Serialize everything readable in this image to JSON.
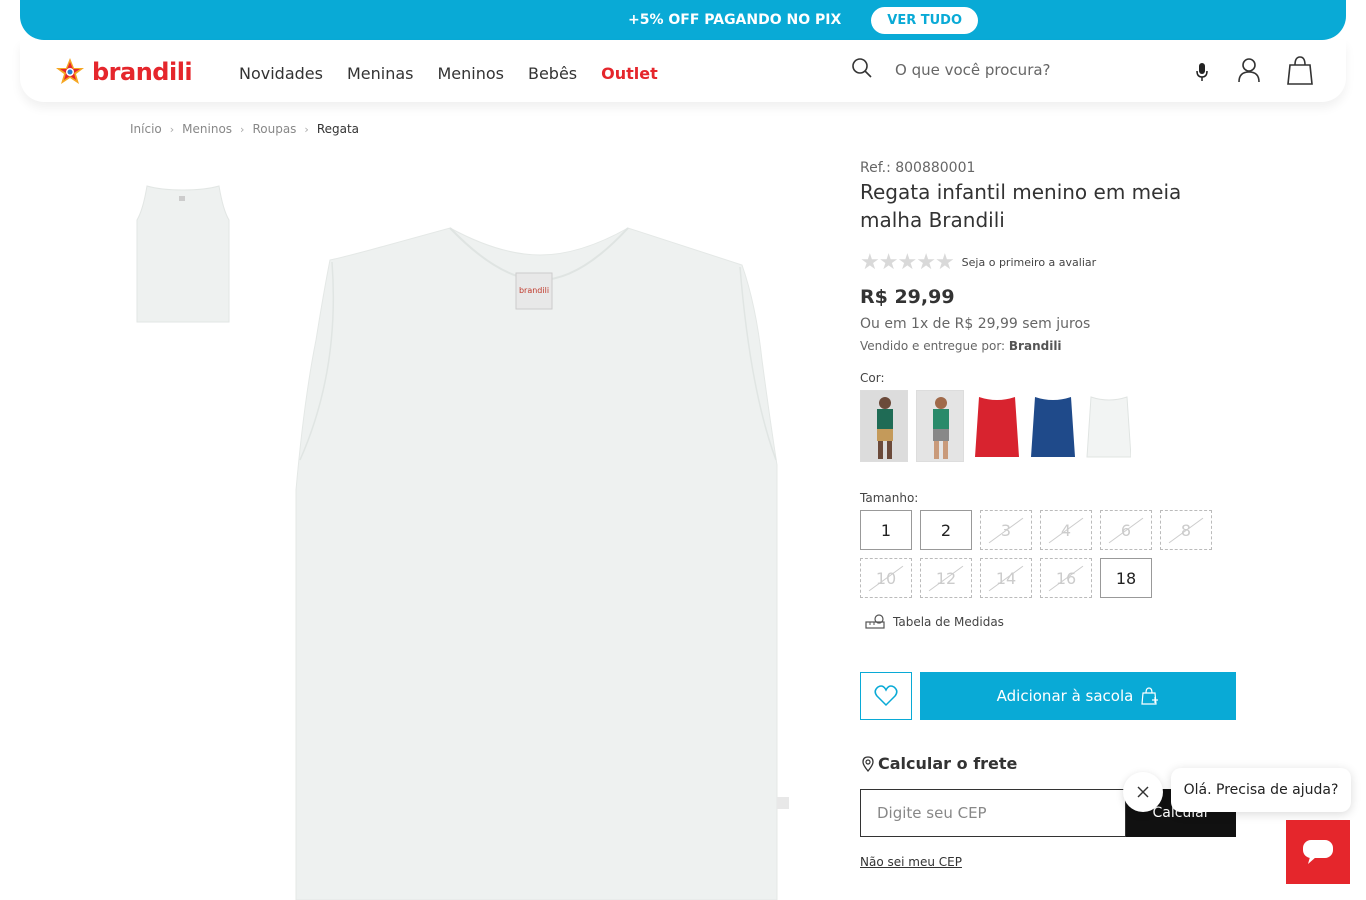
{
  "promo": {
    "text": "+5% OFF PAGANDO NO PIX",
    "button": "VER TUDO"
  },
  "header": {
    "logo": "brandili",
    "nav": [
      "Novidades",
      "Meninas",
      "Meninos",
      "Bebês",
      "Outlet"
    ],
    "search_placeholder": "O que você procura?",
    "icons": [
      "search-icon",
      "mic-icon",
      "user-icon",
      "bag-icon"
    ]
  },
  "breadcrumb": [
    "Início",
    "Meninos",
    "Roupas",
    "Regata"
  ],
  "product": {
    "ref": "Ref.: 800880001",
    "title": "Regata infantil menino em meia malha Brandili",
    "rating_text": "Seja o primeiro a avaliar",
    "price": "R$ 29,99",
    "installment": "Ou em 1x de R$ 29,99 sem juros",
    "seller_label": "Vendido e entregue por:",
    "seller": "Brandili",
    "color_label": "Cor:",
    "colors": [
      {
        "name": "green-model",
        "hex": "#1f6b55"
      },
      {
        "name": "teal-model",
        "hex": "#2a8a6a"
      },
      {
        "name": "red",
        "hex": "#d8232f"
      },
      {
        "name": "navy",
        "hex": "#1f4a8a"
      },
      {
        "name": "white",
        "hex": "#f2f4f3"
      }
    ],
    "size_label": "Tamanho:",
    "sizes": [
      {
        "label": "1",
        "available": true
      },
      {
        "label": "2",
        "available": true
      },
      {
        "label": "3",
        "available": false
      },
      {
        "label": "4",
        "available": false
      },
      {
        "label": "6",
        "available": false
      },
      {
        "label": "8",
        "available": false
      },
      {
        "label": "10",
        "available": false
      },
      {
        "label": "12",
        "available": false
      },
      {
        "label": "14",
        "available": false
      },
      {
        "label": "16",
        "available": false
      },
      {
        "label": "18",
        "available": true
      }
    ],
    "measure_link": "Tabela de Medidas",
    "add_to_cart": "Adicionar à sacola"
  },
  "shipping": {
    "title": "Calcular o frete",
    "cep_placeholder": "Digite seu CEP",
    "calc_button": "Calcular",
    "no_cep_link": "Não sei meu CEP"
  },
  "chat": {
    "message": "Olá. Precisa de ajuda?"
  },
  "colors": {
    "accent": "#09aad6",
    "brand_red": "#e5262c",
    "chat_red": "#e5262c"
  }
}
